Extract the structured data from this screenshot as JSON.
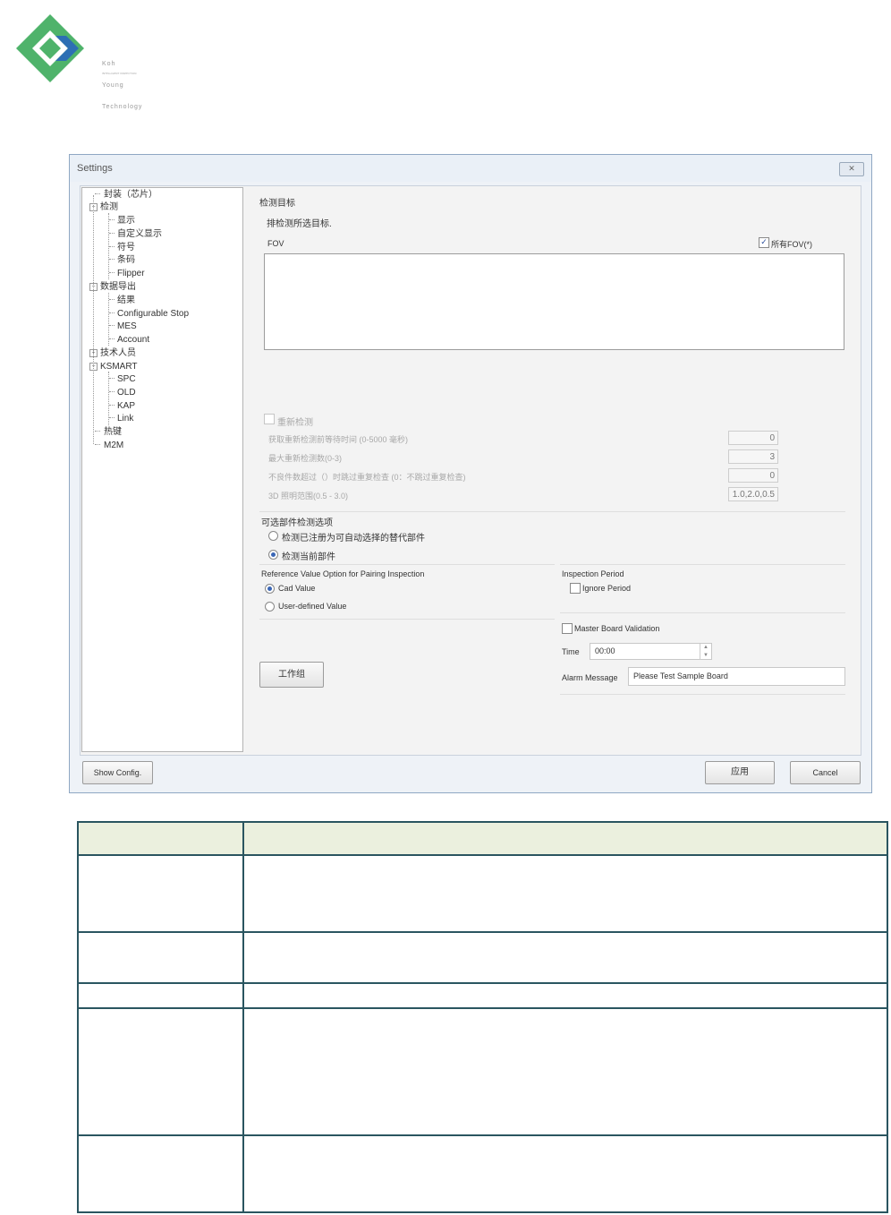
{
  "logo": {
    "lines": [
      "Koh",
      "Young",
      "Technology"
    ],
    "tagline": "INTELLIGENT INSPECTION",
    "colors": {
      "green": "#4fb36b",
      "blue": "#2d6fb4"
    }
  },
  "dialog": {
    "title": "Settings",
    "close_icon": "close-icon",
    "tree": [
      {
        "label": "封装（芯片）",
        "level": 0,
        "expander": ""
      },
      {
        "label": "检测",
        "level": 0,
        "expander": "−"
      },
      {
        "label": "显示",
        "level": 1
      },
      {
        "label": "自定义显示",
        "level": 1
      },
      {
        "label": "符号",
        "level": 1
      },
      {
        "label": "条码",
        "level": 1
      },
      {
        "label": "Flipper",
        "level": 1
      },
      {
        "label": "数据导出",
        "level": 0,
        "expander": "−"
      },
      {
        "label": "结果",
        "level": 1
      },
      {
        "label": "Configurable Stop",
        "level": 1
      },
      {
        "label": "MES",
        "level": 1
      },
      {
        "label": "Account",
        "level": 1
      },
      {
        "label": "技术人员",
        "level": 0,
        "expander": "+"
      },
      {
        "label": "KSMART",
        "level": 0,
        "expander": "−"
      },
      {
        "label": "SPC",
        "level": 1
      },
      {
        "label": "OLD",
        "level": 1
      },
      {
        "label": "KAP",
        "level": 1
      },
      {
        "label": "Link",
        "level": 1
      },
      {
        "label": "热键",
        "level": 0,
        "expander": ""
      },
      {
        "label": "M2M",
        "level": 0,
        "expander": ""
      }
    ],
    "panel": {
      "section_title": "检测目标",
      "instruction": "排检测所选目标.",
      "fov_label": "FOV",
      "all_fov_label": "所有FOV(*)",
      "all_fov_checked": true,
      "recheck_label": "重新检测",
      "recheck_rows": [
        {
          "label": "获取重新检测前等待时间 (0-5000 毫秒)",
          "value": "0"
        },
        {
          "label": "最大重新检测数(0-3)",
          "value": "3"
        },
        {
          "label": "不良件数超过（）时跳过重复检查 (0：不跳过重复检查)",
          "value": "0"
        },
        {
          "label": "3D 照明范围(0.5 - 3.0)",
          "value": "1.0,2.0,0.5"
        }
      ],
      "alt_part_title": "可选部件检测选项",
      "alt_part_options": [
        {
          "label": "检测已注册为可自动选择的替代部件",
          "selected": false
        },
        {
          "label": "检测当前部件",
          "selected": true
        }
      ],
      "pairing": {
        "title": "Reference Value Option for Pairing Inspection",
        "options": [
          {
            "label": "Cad Value",
            "selected": true
          },
          {
            "label": "User-defined Value",
            "selected": false
          }
        ]
      },
      "inspection_period": {
        "title": "Inspection Period",
        "ignore_label": "Ignore Period",
        "ignore_checked": false
      },
      "workgroup_button": "工作组",
      "master_board": {
        "label": "Master Board Validation",
        "checked": false,
        "time_label": "Time",
        "time_value": "00:00",
        "alarm_label": "Alarm Message",
        "alarm_value": "Please Test Sample Board"
      }
    },
    "footer": {
      "show_config": "Show Config.",
      "apply": "应用",
      "cancel": "Cancel"
    }
  },
  "doc_table": {
    "headers": [
      "",
      ""
    ],
    "rows": [
      [
        "",
        ""
      ],
      [
        "",
        ""
      ],
      [
        "",
        ""
      ],
      [
        "",
        ""
      ],
      [
        "",
        ""
      ]
    ]
  }
}
